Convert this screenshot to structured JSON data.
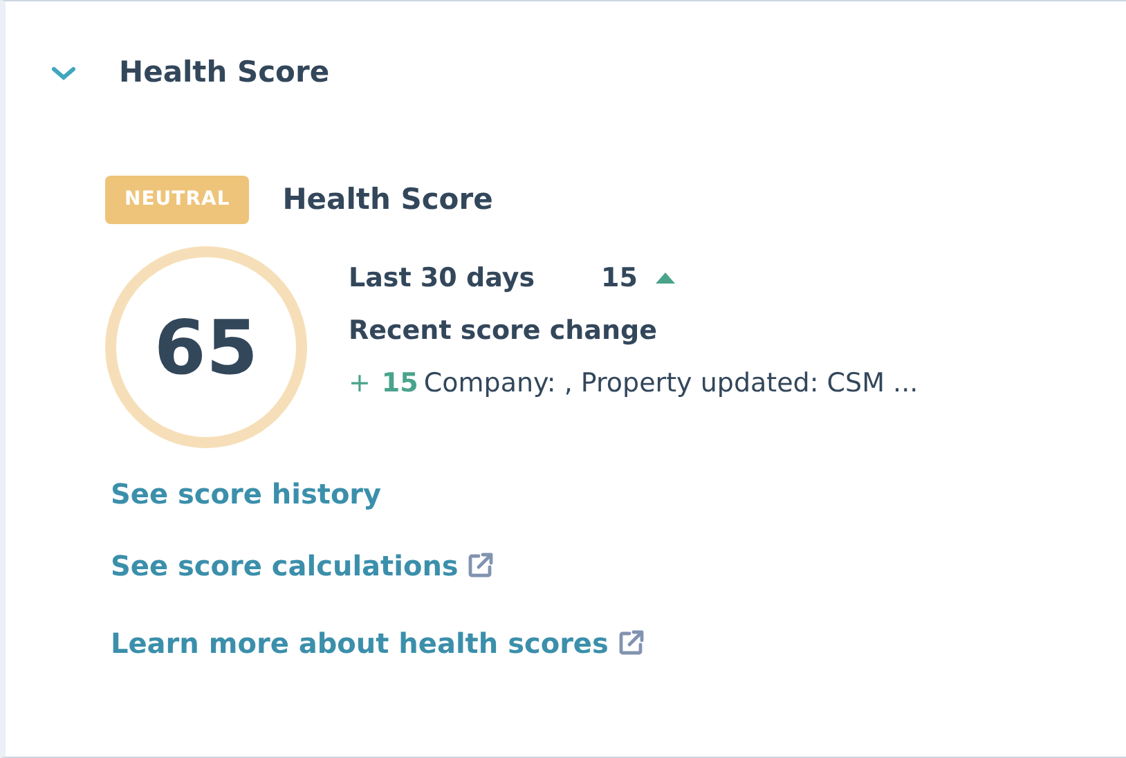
{
  "section": {
    "title": "Health Score",
    "expanded": true
  },
  "badge": {
    "label": "NEUTRAL",
    "kind": "neutral"
  },
  "heading": "Health Score",
  "score": "65",
  "period": {
    "label": "Last 30 days",
    "value": "15",
    "rising": true
  },
  "recent_change": {
    "title": "Recent score change",
    "sign": "+",
    "value": "15",
    "description": "Company: , Property updated: CSM ..."
  },
  "links": [
    {
      "label": "See score history",
      "external": false
    },
    {
      "label": "See score calculations",
      "external": true
    },
    {
      "label": "Learn more about health scores",
      "external": true
    }
  ]
}
